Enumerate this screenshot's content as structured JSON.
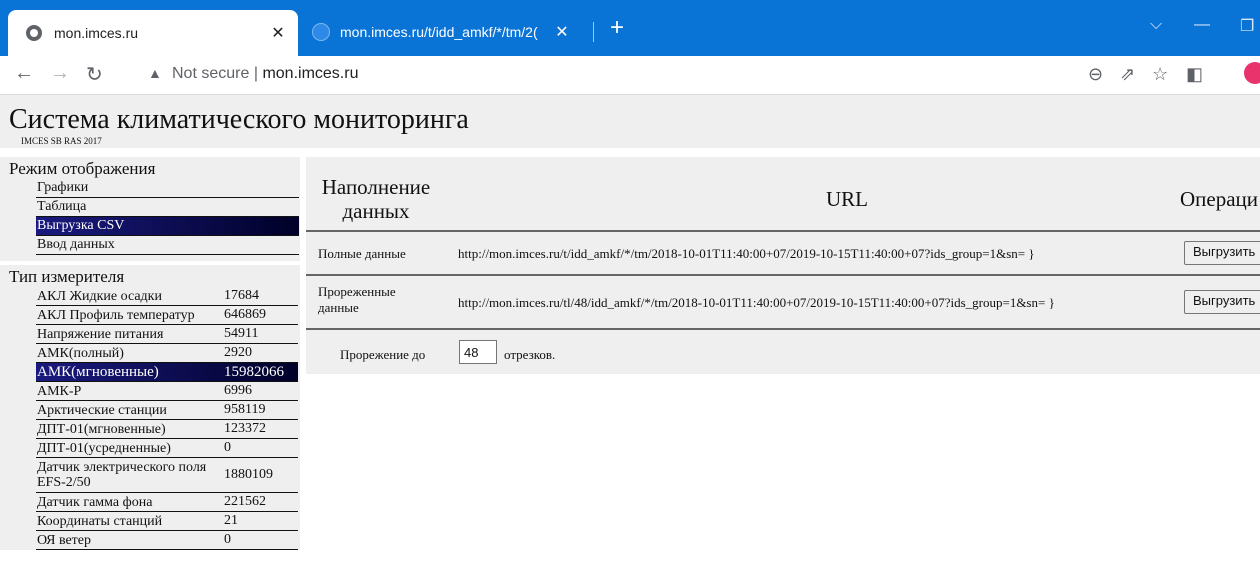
{
  "browser": {
    "tabs": [
      {
        "title": "mon.imces.ru",
        "active": true
      },
      {
        "title": "mon.imces.ru/t/idd_amkf/*/tm/2(",
        "active": false
      }
    ],
    "security_label": "Not secure",
    "url_host": "mon.imces.ru",
    "accent_color": "#0a74d6"
  },
  "site": {
    "title": "Система климатического мониторинга",
    "subtitle": "IMCES SB RAS 2017"
  },
  "sidebar": {
    "mode_heading": "Режим отображения",
    "modes": [
      {
        "label": "Графики"
      },
      {
        "label": "Таблица"
      },
      {
        "label": "Выгрузка CSV"
      },
      {
        "label": "Ввод данных"
      }
    ],
    "meter_heading": "Тип измерителя",
    "meters": [
      {
        "name": "АКЛ Жидкие осадки",
        "count": "17684"
      },
      {
        "name": "АКЛ Профиль температур",
        "count": "646869"
      },
      {
        "name": "Напряжение питания",
        "count": "54911"
      },
      {
        "name": "АМК(полный)",
        "count": "2920"
      },
      {
        "name": "АМК(мгновенные)",
        "count": "15982066"
      },
      {
        "name": "АМК-Р",
        "count": "6996"
      },
      {
        "name": "Арктические станции",
        "count": "958119"
      },
      {
        "name": "ДПТ-01(мгновенные)",
        "count": "123372"
      },
      {
        "name": "ДПТ-01(усредненные)",
        "count": "0"
      },
      {
        "name": "Датчик электрического поля EFS-2/50",
        "count": "1880109"
      },
      {
        "name": "Датчик гамма фона",
        "count": "221562"
      },
      {
        "name": "Координаты станций",
        "count": "21"
      },
      {
        "name": "ОЯ ветер",
        "count": "0"
      }
    ]
  },
  "main": {
    "col_fill": "Наполнение данных",
    "col_url": "URL",
    "col_ops": "Операци",
    "rows": [
      {
        "label": "Полные данные",
        "url": "http://mon.imces.ru/t/idd_amkf/*/tm/2018-10-01T11:40:00+07/2019-10-15T11:40:00+07?ids_group=1&sn= }",
        "button": "Выгрузить"
      },
      {
        "label": "Прореженные данные",
        "url": "http://mon.imces.ru/tl/48/idd_amkf/*/tm/2018-10-01T11:40:00+07/2019-10-15T11:40:00+07?ids_group=1&sn= }",
        "button": "Выгрузить"
      }
    ],
    "thinning_label": "Прорежение до",
    "thinning_value": "48",
    "thinning_suffix": "отрезков."
  }
}
